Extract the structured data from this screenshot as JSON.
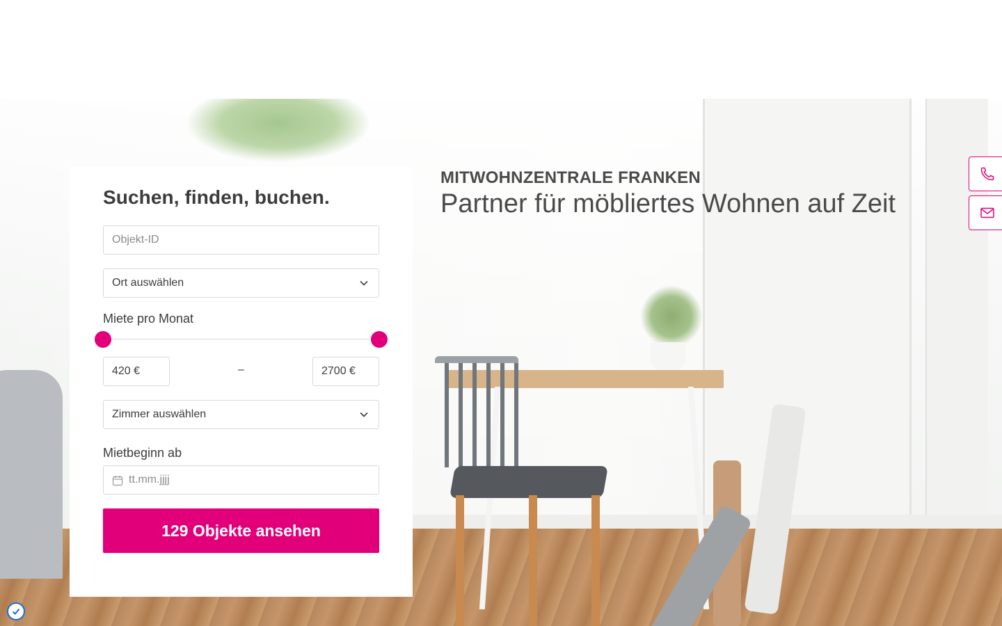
{
  "search": {
    "title": "Suchen, finden, buchen.",
    "object_id_placeholder": "Objekt-ID",
    "location_select": "Ort auswählen",
    "rent_label": "Miete pro Monat",
    "price_min": "420 €",
    "price_separator": "–",
    "price_max": "2700 €",
    "rooms_select": "Zimmer auswählen",
    "start_label": "Mietbeginn ab",
    "date_placeholder": "tt.mm.jjjj",
    "submit_label": "129 Objekte ansehen"
  },
  "slider": {
    "min_fraction": 0,
    "max_fraction": 1
  },
  "hero": {
    "eyebrow": "MITWOHNZENTRALE FRANKEN",
    "headline": "Partner für möbliertes Wohnen auf Zeit"
  },
  "side_actions": [
    {
      "icon": "phone-icon"
    },
    {
      "icon": "mail-icon"
    }
  ],
  "colors": {
    "accent": "#e2007a",
    "text": "#3c3c3c",
    "border": "#d9d9d9"
  }
}
